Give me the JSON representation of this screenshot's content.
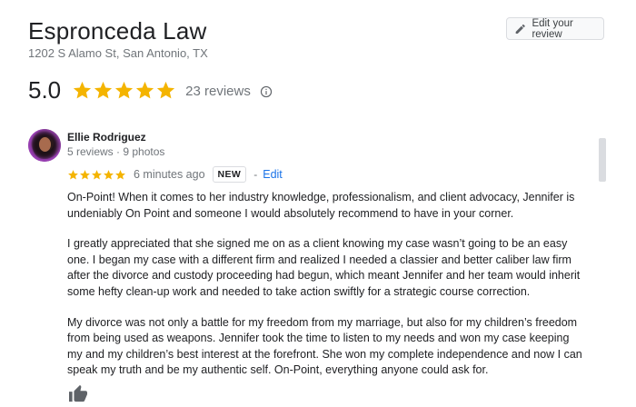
{
  "business": {
    "name": "Espronceda Law",
    "address": "1202 S Alamo St, San Antonio, TX",
    "edit_review_label": "Edit your review"
  },
  "rating": {
    "value": "5.0",
    "stars": 5,
    "review_count": "23 reviews"
  },
  "review": {
    "author": "Ellie Rodriguez",
    "meta": "5 reviews · 9 photos",
    "stars": 5,
    "time": "6 minutes ago",
    "badge": "NEW",
    "separator": "-",
    "edit_label": "Edit",
    "paragraphs": [
      "On-Point! When it comes to her industry knowledge, professionalism, and client advocacy, Jennifer is undeniably On Point and someone I would absolutely recommend to have in your corner.",
      "I greatly appreciated that she signed me on as a client knowing my case wasn’t going to be an easy one. I began my case with a different firm and realized I needed a classier and better caliber law firm after the divorce and custody proceeding had begun, which meant Jennifer and her team would inherit some hefty clean-up work and needed to take action swiftly for a strategic course correction.",
      "My divorce was not only a battle for my freedom from my marriage, but also for my children’s freedom from being used as weapons. Jennifer took the time to listen to my needs and won my case keeping my and my children’s best interest at the forefront. She won my complete independence and now I can speak my truth and be my authentic self. On-Point, everything anyone could ask for."
    ]
  },
  "colors": {
    "star": "#f4b400",
    "link": "#1a73e8",
    "muted": "#70757a"
  },
  "icons": {
    "edit": "pencil-icon",
    "info": "info-icon",
    "like": "thumbs-up-icon"
  }
}
